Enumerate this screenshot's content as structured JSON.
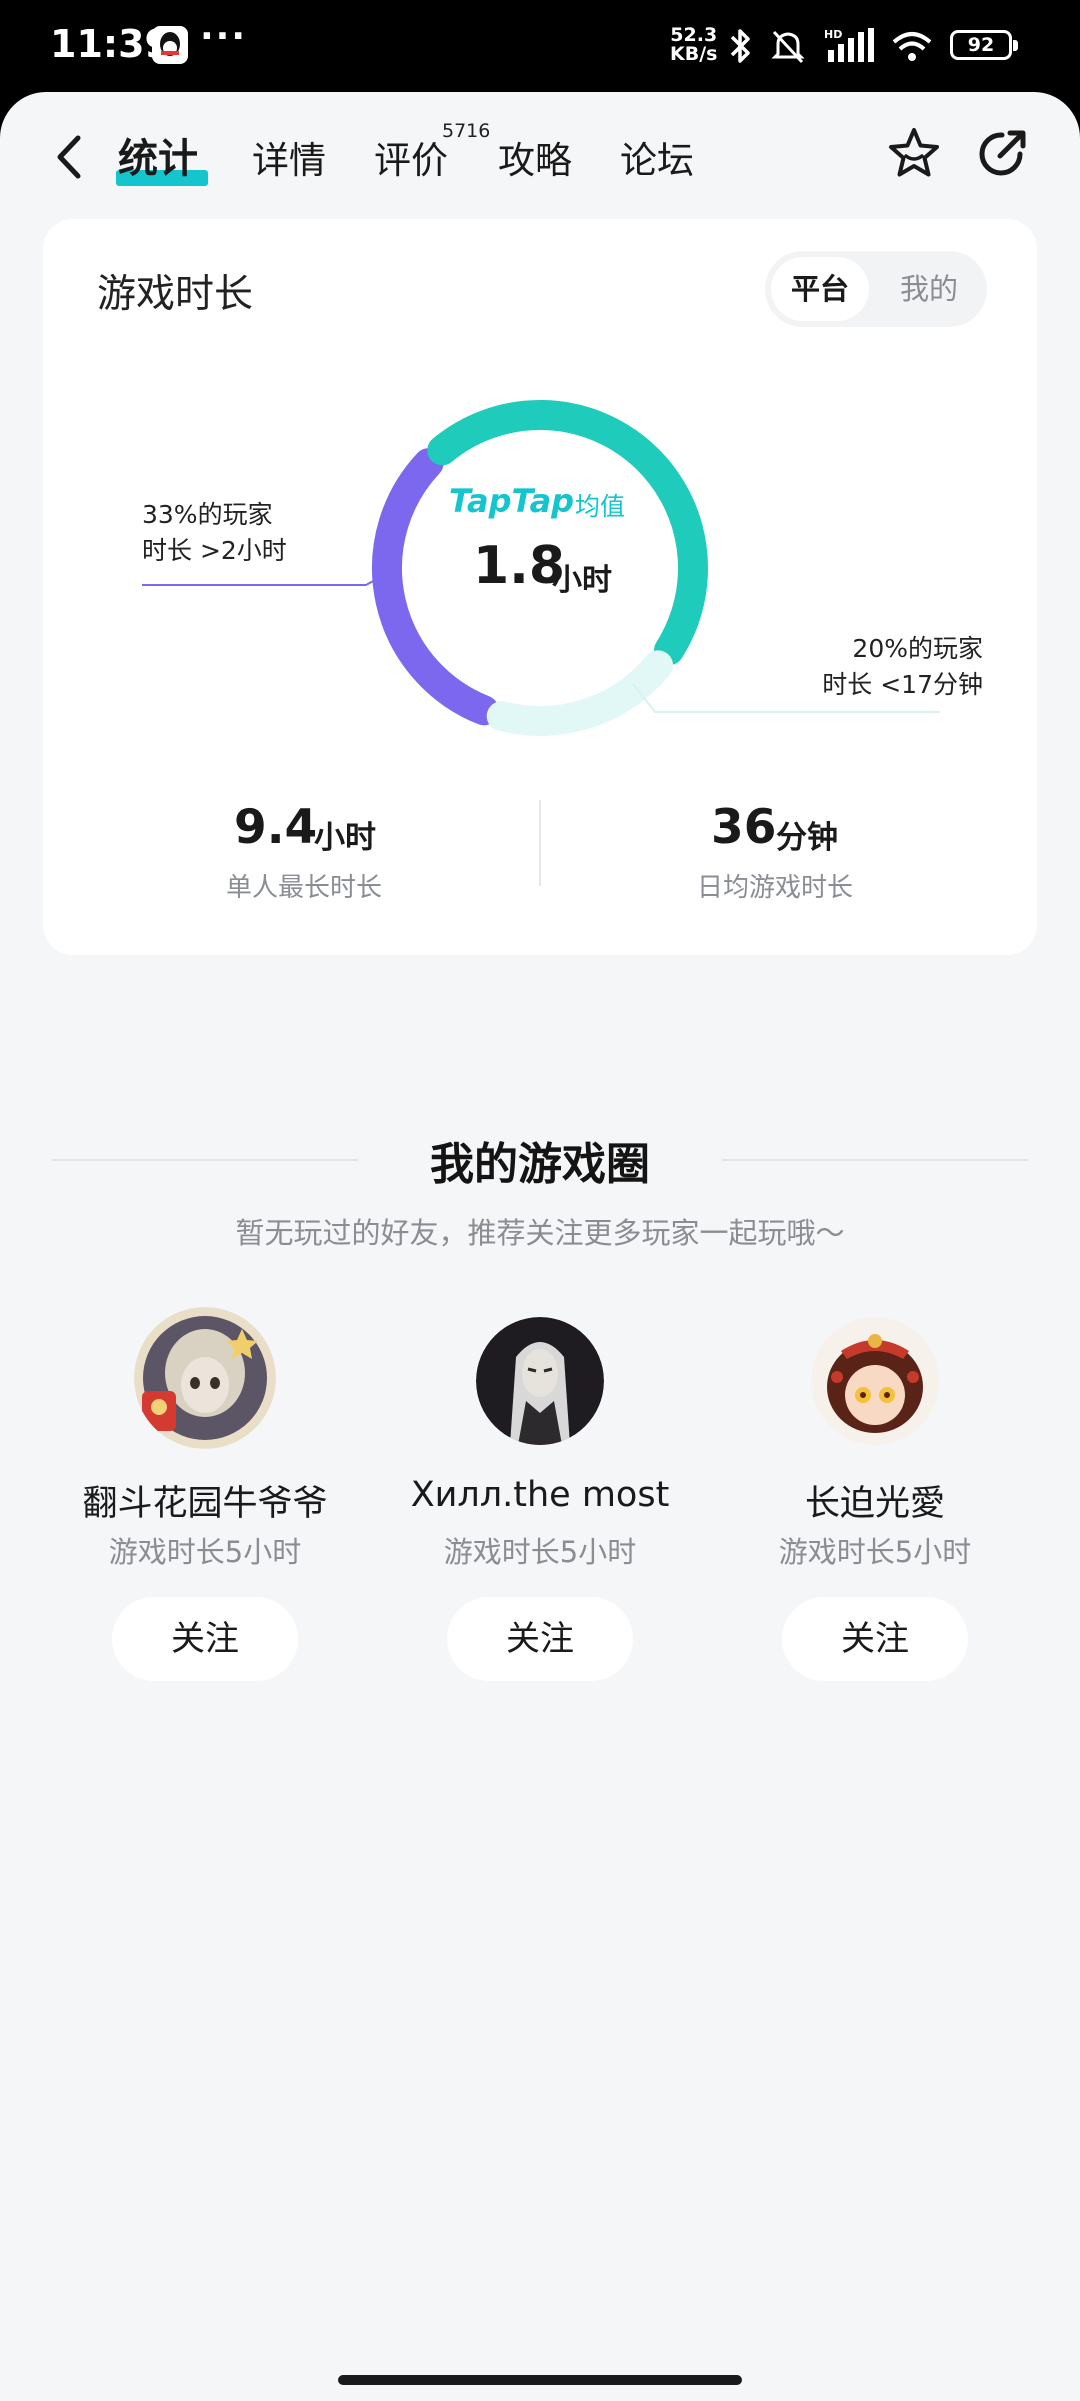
{
  "status_bar": {
    "time": "11:39",
    "dots": "···",
    "net_speed_value": "52.3",
    "net_speed_unit": "KB/s",
    "battery": "92",
    "icons": [
      "qq-icon",
      "bluetooth-icon",
      "mute-icon",
      "hd-signal-icon",
      "wifi-icon",
      "battery-icon"
    ]
  },
  "nav": {
    "tabs": [
      {
        "label": "统计",
        "active": true
      },
      {
        "label": "详情",
        "active": false
      },
      {
        "label": "评价",
        "active": false,
        "badge": "5716"
      },
      {
        "label": "攻略",
        "active": false
      },
      {
        "label": "论坛",
        "active": false
      }
    ],
    "icons": [
      "back-icon",
      "favorite-star-icon",
      "share-icon"
    ],
    "accent_color": "#15c5ce"
  },
  "playtime_card": {
    "title": "游戏时长",
    "segment": {
      "options": [
        "平台",
        "我的"
      ],
      "selected": "平台"
    },
    "center": {
      "brand": "TapTap",
      "label": "均值",
      "value": "1.8",
      "unit": "小时"
    },
    "annotation_left": {
      "line1": "33%的玩家",
      "line2": "时长 >2小时"
    },
    "annotation_right": {
      "line1": "20%的玩家",
      "line2": "时长 <17分钟"
    },
    "donut": {
      "segments": [
        {
          "share_percent": 33,
          "meaning": ">2小时",
          "color": "#7b68ee"
        },
        {
          "share_percent": 47,
          "meaning": "",
          "color": "#1fcbbb"
        },
        {
          "share_percent": 20,
          "meaning": "<17分钟",
          "color": "#e1f8f6"
        }
      ]
    },
    "stats": [
      {
        "value": "9.4",
        "unit": "小时",
        "label": "单人最长时长"
      },
      {
        "value": "36",
        "unit": "分钟",
        "label": "日均游戏时长"
      }
    ]
  },
  "game_circle": {
    "title": "我的游戏圈",
    "subtitle": "暂无玩过的好友，推荐关注更多玩家一起玩哦～",
    "friends": [
      {
        "name": "翻斗花园牛爷爷",
        "playtime": "游戏时长5小时",
        "button": "关注"
      },
      {
        "name": "Хилл.the most",
        "playtime": "游戏时长5小时",
        "button": "关注"
      },
      {
        "name": "长迫光愛",
        "playtime": "游戏时长5小时",
        "button": "关注"
      }
    ]
  }
}
